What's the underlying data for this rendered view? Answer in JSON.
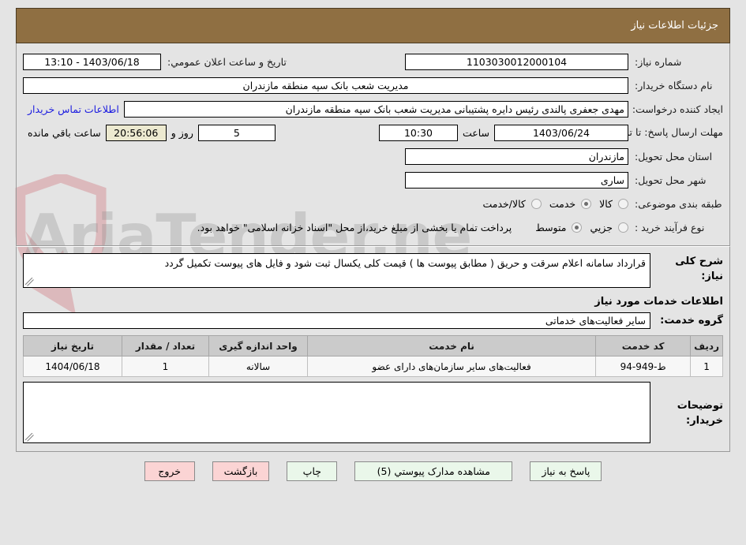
{
  "header": {
    "title": "جزئیات اطلاعات نیاز"
  },
  "form": {
    "need_number_label": "شماره نیاز:",
    "need_number_value": "1103030012000104",
    "announce_datetime_label": "تاریخ و ساعت اعلان عمومي:",
    "announce_datetime_value": "1403/06/18 - 13:10",
    "buyer_org_label": "نام دستگاه خریدار:",
    "buyer_org_value": "مدیریت شعب بانک سپه منطقه مازندران",
    "creator_label": "ایجاد کننده درخواست:",
    "creator_value": "مهدی جعفری پالندی رئیس دایره پشتیبانی مدیریت شعب بانک سپه منطقه مازندران",
    "contact_link": "اطلاعات تماس خریدار",
    "deadline_label": "مهلت ارسال پاسخ: تا تاریخ:",
    "deadline_date": "1403/06/24",
    "deadline_time_label": "ساعت",
    "deadline_time": "10:30",
    "remaining_days": "5",
    "remaining_days_suffix": "روز و",
    "remaining_clock": "20:56:06",
    "remaining_suffix": "ساعت باقي مانده",
    "province_label": "استان محل تحویل:",
    "province_value": "مازندران",
    "city_label": "شهر محل تحویل:",
    "city_value": "ساری",
    "category_label": "طبقه بندی موضوعی:",
    "category_options": [
      {
        "label": "کالا",
        "selected": false
      },
      {
        "label": "خدمت",
        "selected": true
      },
      {
        "label": "کالا/خدمت",
        "selected": false
      }
    ],
    "process_label": "نوع فرآیند خرید :",
    "process_options": [
      {
        "label": "جزيي",
        "selected": false
      },
      {
        "label": "متوسط",
        "selected": true
      }
    ],
    "payment_note": "پرداخت تمام یا بخشی از مبلغ خرید،از محل \"اسناد خزانه اسلامی\" خواهد بود."
  },
  "description": {
    "label": "شرح کلی نیاز:",
    "text": "قرارداد سامانه اعلام سرقت و حریق  ( مطابق پیوست ها ) قیمت کلی یکسال ثبت شود  و فایل های پیوست تکمیل گردد"
  },
  "services": {
    "section_title": "اطلاعات خدمات مورد نیاز",
    "group_label": "گروه خدمت:",
    "group_value": "سایر فعالیت‌های خدماتی",
    "columns": [
      "ردیف",
      "کد خدمت",
      "نام خدمت",
      "واحد اندازه گیری",
      "تعداد / مقدار",
      "تاریخ نیاز"
    ],
    "rows": [
      {
        "row": "1",
        "code": "ط-949-94",
        "name": "فعالیت‌های سایر سازمان‌های دارای عضو",
        "unit": "سالانه",
        "quantity": "1",
        "need_date": "1404/06/18"
      }
    ]
  },
  "buyer_notes": {
    "label": "توضیحات خریدار:",
    "text": ""
  },
  "footer": {
    "buttons": [
      {
        "name": "respond",
        "label": "پاسخ به نیاز",
        "style": "green"
      },
      {
        "name": "view-attachments",
        "label": "مشاهده مدارک پیوستي (5)",
        "style": "green"
      },
      {
        "name": "print",
        "label": "چاپ",
        "style": "green"
      },
      {
        "name": "back",
        "label": "بازگشت",
        "style": "red"
      },
      {
        "name": "exit",
        "label": "خروج",
        "style": "red"
      }
    ]
  },
  "watermark": {
    "text": "AriaTender.net"
  },
  "colors": {
    "header_bg": "#8f6f42",
    "page_bg": "#e4e4e4",
    "link": "#1a1ae0",
    "highlight_field": "#ece9d0",
    "btn_green": "#eaf7ea",
    "btn_red": "#fbd4d4"
  }
}
